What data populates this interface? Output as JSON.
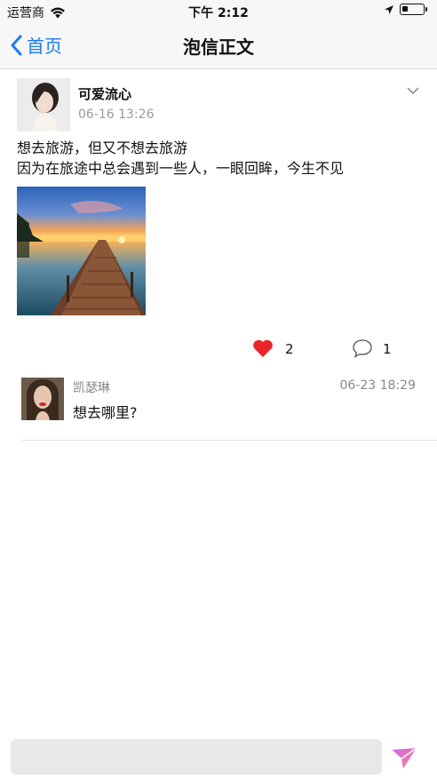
{
  "status_bar": {
    "carrier": "运营商",
    "time": "下午 2:12",
    "battery_level": 0.3
  },
  "nav": {
    "back_label": "首页",
    "title": "泡信正文"
  },
  "post": {
    "author": "可爱流心",
    "time": "06-16 13:26",
    "text_lines": [
      "想去旅游，但又不想去旅游",
      "因为在旅途中总会遇到一些人，一眼回眸，今生不见"
    ],
    "like_count": "2",
    "comment_count": "1"
  },
  "comments": [
    {
      "name": "凯瑟琳",
      "time": "06-23 18:29",
      "text": "想去哪里?"
    }
  ],
  "input": {
    "placeholder": ""
  },
  "colors": {
    "accent": "#1d7bf0",
    "like": "#e8262a",
    "send_gradient_start": "#c56cf0",
    "send_gradient_end": "#ff7b8a"
  }
}
